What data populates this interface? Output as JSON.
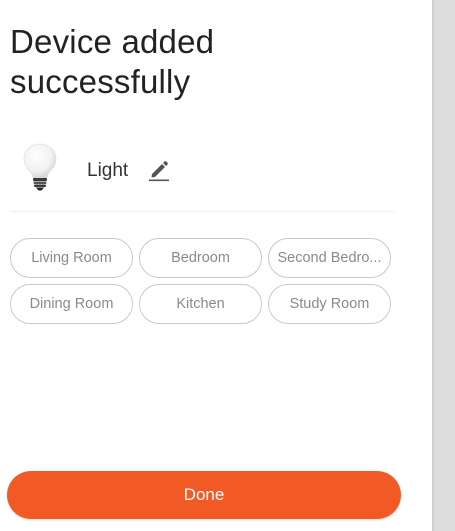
{
  "header": {
    "title_line1": "Device added",
    "title_line2": "successfully"
  },
  "device": {
    "icon": "light-bulb-icon",
    "name": "Light",
    "edit_icon": "pencil-icon"
  },
  "rooms": [
    "Living Room",
    "Bedroom",
    "Second Bedro...",
    "Dining Room",
    "Kitchen",
    "Study Room"
  ],
  "actions": {
    "done_label": "Done"
  },
  "colors": {
    "accent": "#f15a24",
    "chip_border": "#c9c9c9",
    "chip_text": "#8a8a8a",
    "side_panel": "#dcdcdc"
  }
}
